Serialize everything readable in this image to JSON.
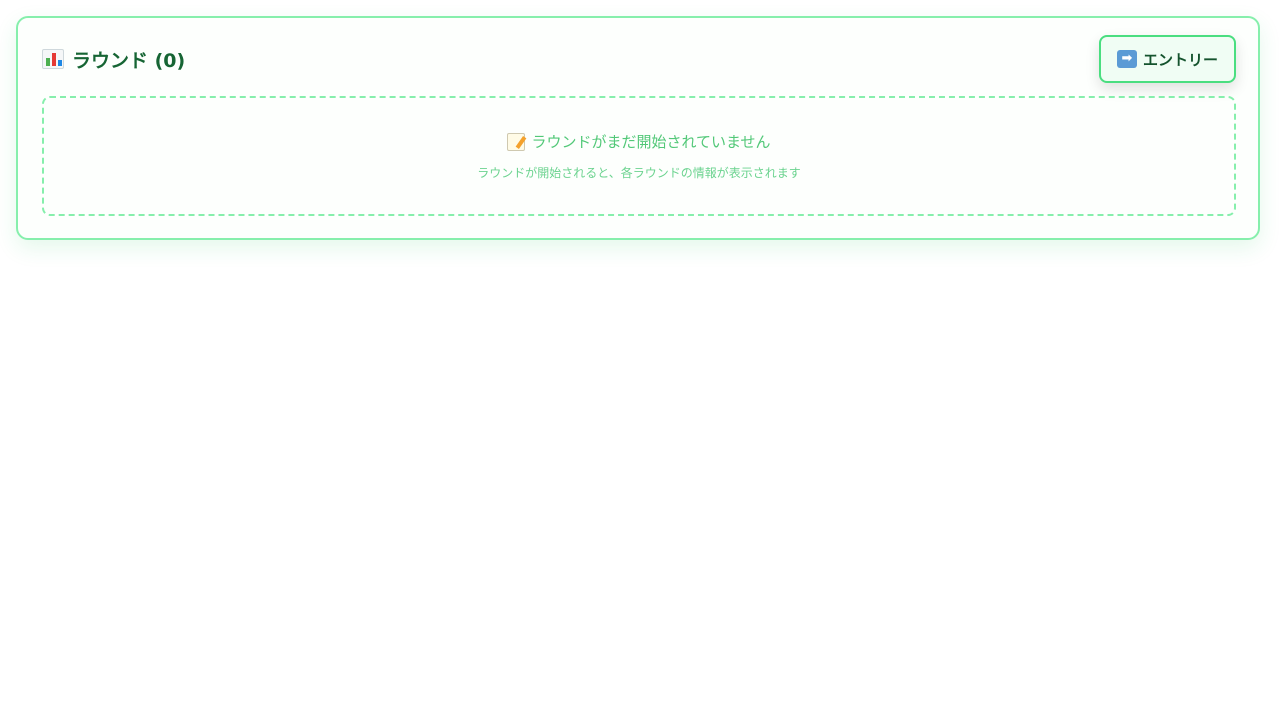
{
  "rounds_panel": {
    "title": "ラウンド (0)",
    "title_icon": "bar-chart-icon",
    "entry_button": {
      "icon": "right-arrow-icon",
      "label": "エントリー"
    },
    "empty_state": {
      "icon": "memo-icon",
      "title": "ラウンドがまだ開始されていません",
      "description": "ラウンドが開始されると、各ラウンドの情報が表示されます"
    }
  },
  "colors": {
    "border": "#86efac",
    "title_text": "#166534",
    "button_bg": "#f0fdf4",
    "button_border": "#4ade80",
    "empty_text": "#52c878"
  }
}
